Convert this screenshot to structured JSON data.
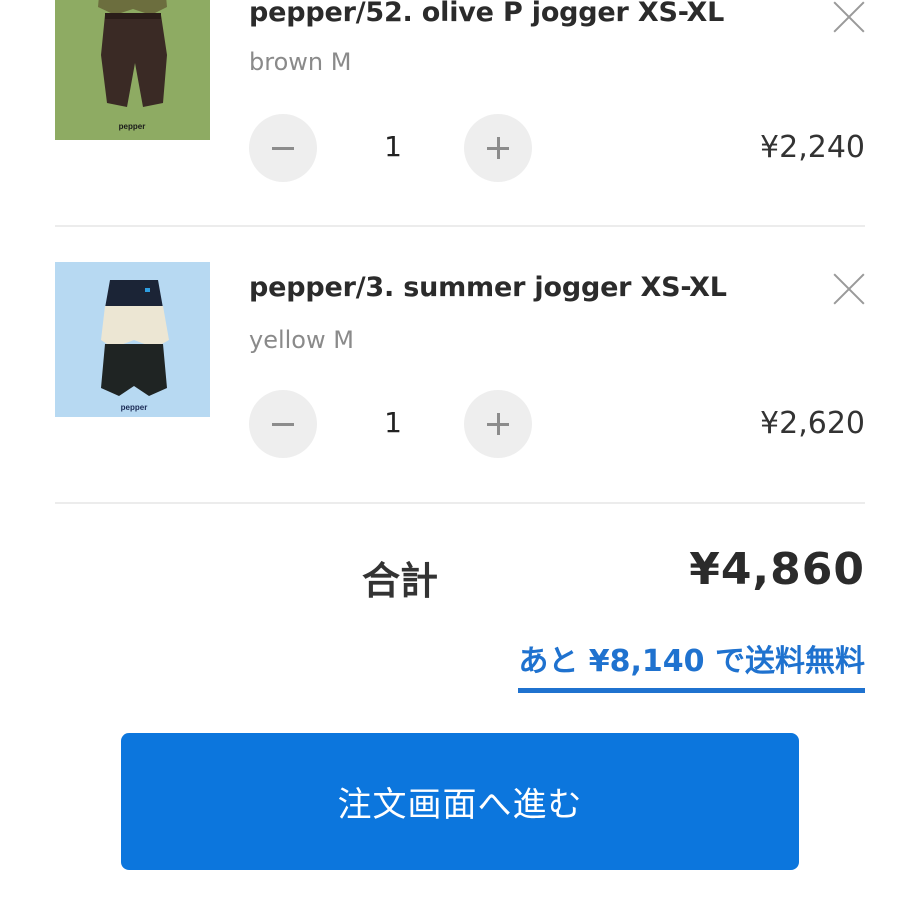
{
  "cart": {
    "items": [
      {
        "title": "pepper/52. olive P jogger XS-XL",
        "variant": "brown M",
        "quantity": "1",
        "price": "¥2,240",
        "thumb_brand": "pepper",
        "thumb_bg": "#8eab63"
      },
      {
        "title": "pepper/3. summer jogger XS-XL",
        "variant": "yellow M",
        "quantity": "1",
        "price": "¥2,620",
        "thumb_brand": "pepper",
        "thumb_bg": "#b7d9f2"
      }
    ]
  },
  "summary": {
    "total_label": "合計",
    "total_amount": "¥4,860",
    "free_shipping_text": "あと ¥8,140 で送料無料"
  },
  "checkout": {
    "button_label": "注文画面へ進む"
  },
  "colors": {
    "accent": "#0c76dd",
    "link": "#1f72cf"
  },
  "icons": {
    "remove": "close-icon",
    "decrease": "minus-icon",
    "increase": "plus-icon"
  }
}
